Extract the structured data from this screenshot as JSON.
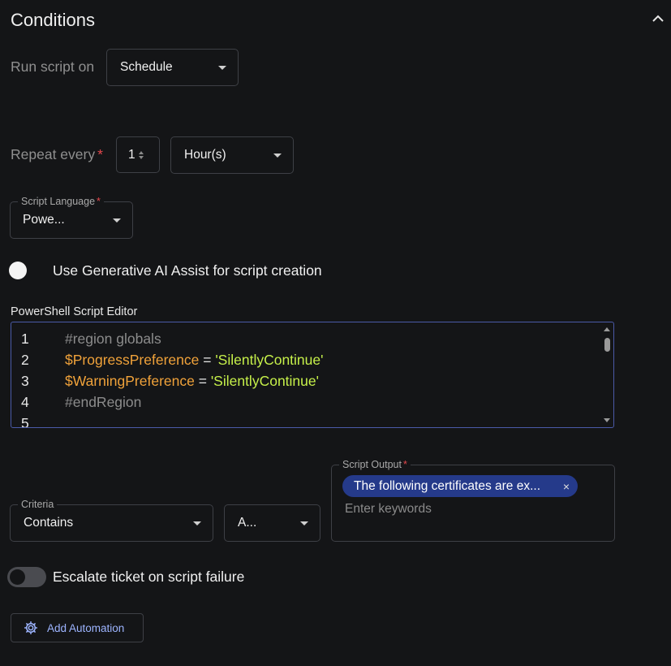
{
  "section": {
    "title": "Conditions"
  },
  "run_script": {
    "label": "Run script on",
    "selected": "Schedule"
  },
  "repeat": {
    "label": "Repeat every",
    "required_mark": "*",
    "value": "1",
    "unit": "Hour(s)"
  },
  "script_language": {
    "label": "Script Language",
    "required_mark": "*",
    "selected": "Powe..."
  },
  "ai_assist": {
    "label": "Use Generative AI Assist for script creation"
  },
  "editor": {
    "label": "PowerShell Script Editor",
    "lines": [
      {
        "n": "1",
        "comment": "#region globals"
      },
      {
        "n": "2",
        "var": "$ProgressPreference",
        "op": " = ",
        "str": "'SilentlyContinue'"
      },
      {
        "n": "3",
        "var": "$WarningPreference",
        "op": " = ",
        "str": "'SilentlyContinue'"
      },
      {
        "n": "4",
        "comment": "#endRegion"
      },
      {
        "n": "5"
      }
    ]
  },
  "criteria": {
    "label": "Criteria",
    "selected": "Contains",
    "secondary": "A..."
  },
  "script_output": {
    "label": "Script Output",
    "required_mark": "*",
    "chip": "The following certificates are ex...",
    "chip_close": "×",
    "placeholder": "Enter keywords"
  },
  "escalate": {
    "label": "Escalate ticket on script failure",
    "enabled": false
  },
  "add_automation": {
    "label": "Add Automation"
  },
  "colors": {
    "background": "#141517",
    "accent": "#9db4ff",
    "chip": "#253a8a",
    "required": "#e5484d",
    "editor_border": "#4a5aa8"
  }
}
